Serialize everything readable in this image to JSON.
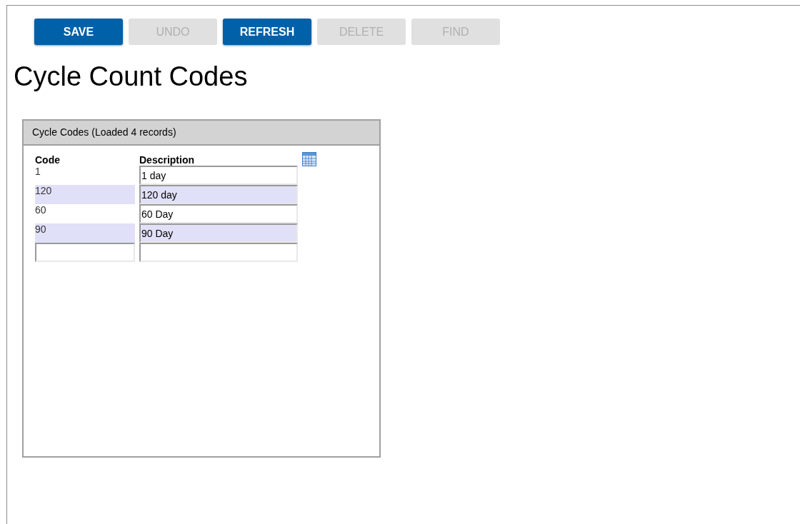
{
  "toolbar": [
    {
      "label": "SAVE",
      "disabled": false
    },
    {
      "label": "UNDO",
      "disabled": true
    },
    {
      "label": "REFRESH",
      "disabled": false
    },
    {
      "label": "DELETE",
      "disabled": true
    },
    {
      "label": "FIND",
      "disabled": true
    }
  ],
  "page_title": "Cycle Count Codes",
  "panel": {
    "title": "Cycle Codes (Loaded 4 records)",
    "columns": [
      "Code",
      "Description"
    ],
    "rows": [
      {
        "kind": "record",
        "code": "1",
        "description": "1 day"
      },
      {
        "kind": "record",
        "code": "120",
        "description": "120 day"
      },
      {
        "kind": "record",
        "code": "60",
        "description": "60 Day"
      },
      {
        "kind": "record",
        "code": "90",
        "description": "90 Day"
      },
      {
        "kind": "new"
      }
    ]
  }
}
